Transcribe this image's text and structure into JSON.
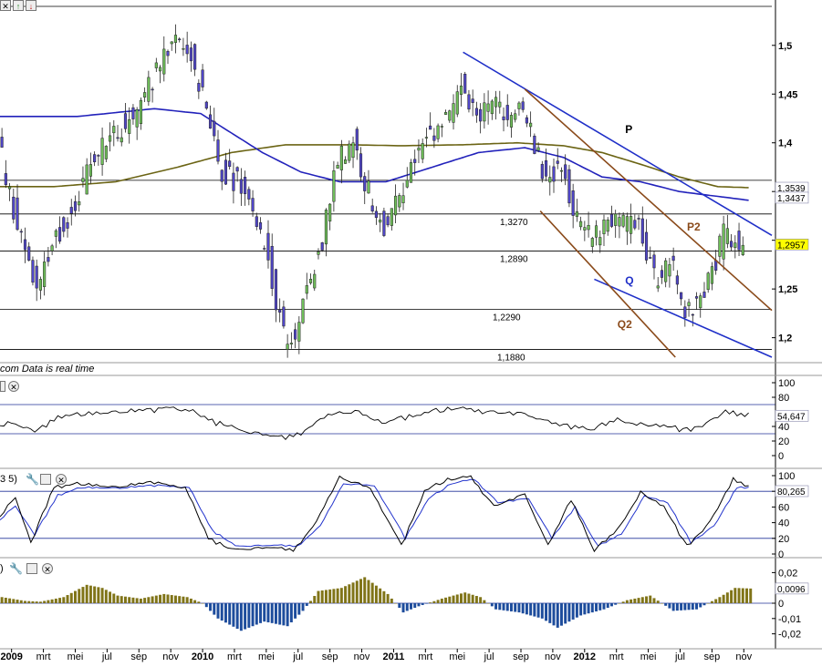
{
  "status_text": "com  Data is real time",
  "colors": {
    "candle_up": "#6fbf5a",
    "candle_down": "#5046c8",
    "ma_fast": "#2222bb",
    "ma_slow": "#6b6414",
    "trend_blue": "#1f2fc8",
    "trend_brown": "#8a4a1a",
    "rsi_line": "#000000",
    "stoch_k": "#000000",
    "stoch_d": "#2233cc",
    "macd_pos": "#807418",
    "macd_neg": "#1d4c9c",
    "last_price_bg": "#ffff00"
  },
  "toolbar_icons": [
    "close-icon",
    "arrow-up-icon",
    "arrow-down-icon"
  ],
  "panel_labels": {
    "stoch_params": "3 5)",
    "macd_params": ")"
  },
  "chart_data": [
    {
      "type": "candlestick",
      "name": "main-price-panel",
      "ylim": [
        1.18,
        1.54
      ],
      "yticks": [
        {
          "value": 1.5,
          "label": "1,5"
        },
        {
          "value": 1.45,
          "label": "1,45"
        },
        {
          "value": 1.4,
          "label": "1,4"
        },
        {
          "value": 1.35,
          "label": ""
        },
        {
          "value": 1.3,
          "label": ""
        },
        {
          "value": 1.25,
          "label": "1,25"
        },
        {
          "value": 1.2,
          "label": "1,2"
        }
      ],
      "xticks": [
        {
          "label": "2009",
          "bold": true
        },
        {
          "label": "mrt",
          "bold": false
        },
        {
          "label": "mei",
          "bold": false
        },
        {
          "label": "jul",
          "bold": false
        },
        {
          "label": "sep",
          "bold": false
        },
        {
          "label": "nov",
          "bold": false
        },
        {
          "label": "2010",
          "bold": true
        },
        {
          "label": "mrt",
          "bold": false
        },
        {
          "label": "mei",
          "bold": false
        },
        {
          "label": "jul",
          "bold": false
        },
        {
          "label": "sep",
          "bold": false
        },
        {
          "label": "nov",
          "bold": false
        },
        {
          "label": "2011",
          "bold": true
        },
        {
          "label": "mrt",
          "bold": false
        },
        {
          "label": "mei",
          "bold": false
        },
        {
          "label": "jul",
          "bold": false
        },
        {
          "label": "sep",
          "bold": false
        },
        {
          "label": "nov",
          "bold": false
        },
        {
          "label": "2012",
          "bold": true
        },
        {
          "label": "mrt",
          "bold": false
        },
        {
          "label": "mei",
          "bold": false
        },
        {
          "label": "jul",
          "bold": false
        },
        {
          "label": "sep",
          "bold": false
        },
        {
          "label": "nov",
          "bold": false
        }
      ],
      "weeks_total": 200,
      "price_keypoints": [
        [
          0,
          1.4
        ],
        [
          6,
          1.3
        ],
        [
          10,
          1.25
        ],
        [
          14,
          1.3
        ],
        [
          18,
          1.32
        ],
        [
          24,
          1.38
        ],
        [
          30,
          1.41
        ],
        [
          36,
          1.43
        ],
        [
          42,
          1.48
        ],
        [
          46,
          1.51
        ],
        [
          50,
          1.49
        ],
        [
          54,
          1.43
        ],
        [
          58,
          1.37
        ],
        [
          62,
          1.36
        ],
        [
          66,
          1.33
        ],
        [
          70,
          1.28
        ],
        [
          74,
          1.2
        ],
        [
          77,
          1.2
        ],
        [
          80,
          1.25
        ],
        [
          84,
          1.3
        ],
        [
          88,
          1.38
        ],
        [
          92,
          1.4
        ],
        [
          96,
          1.35
        ],
        [
          100,
          1.31
        ],
        [
          104,
          1.35
        ],
        [
          108,
          1.38
        ],
        [
          112,
          1.41
        ],
        [
          116,
          1.42
        ],
        [
          120,
          1.46
        ],
        [
          124,
          1.42
        ],
        [
          128,
          1.44
        ],
        [
          132,
          1.42
        ],
        [
          136,
          1.44
        ],
        [
          138,
          1.41
        ],
        [
          142,
          1.36
        ],
        [
          146,
          1.38
        ],
        [
          150,
          1.32
        ],
        [
          154,
          1.3
        ],
        [
          158,
          1.32
        ],
        [
          162,
          1.32
        ],
        [
          166,
          1.31
        ],
        [
          170,
          1.26
        ],
        [
          174,
          1.28
        ],
        [
          178,
          1.23
        ],
        [
          182,
          1.24
        ],
        [
          186,
          1.28
        ],
        [
          188,
          1.31
        ],
        [
          192,
          1.295
        ]
      ],
      "ma_fast_keypoints": [
        [
          0,
          1.427
        ],
        [
          20,
          1.427
        ],
        [
          40,
          1.435
        ],
        [
          52,
          1.43
        ],
        [
          60,
          1.41
        ],
        [
          68,
          1.39
        ],
        [
          78,
          1.37
        ],
        [
          88,
          1.36
        ],
        [
          100,
          1.36
        ],
        [
          112,
          1.375
        ],
        [
          124,
          1.39
        ],
        [
          136,
          1.395
        ],
        [
          146,
          1.385
        ],
        [
          156,
          1.365
        ],
        [
          166,
          1.36
        ],
        [
          176,
          1.35
        ],
        [
          186,
          1.345
        ],
        [
          194,
          1.341
        ]
      ],
      "ma_slow_keypoints": [
        [
          0,
          1.355
        ],
        [
          14,
          1.355
        ],
        [
          30,
          1.36
        ],
        [
          46,
          1.375
        ],
        [
          60,
          1.39
        ],
        [
          74,
          1.398
        ],
        [
          90,
          1.398
        ],
        [
          104,
          1.397
        ],
        [
          120,
          1.398
        ],
        [
          134,
          1.4
        ],
        [
          146,
          1.397
        ],
        [
          156,
          1.39
        ],
        [
          166,
          1.378
        ],
        [
          176,
          1.365
        ],
        [
          186,
          1.355
        ],
        [
          194,
          1.354
        ]
      ],
      "horizontal_levels": [
        {
          "value": 1.54,
          "label": ""
        },
        {
          "value": 1.3615,
          "label": ""
        },
        {
          "value": 1.327,
          "label": "1,3270"
        },
        {
          "value": 1.289,
          "label": "1,2890"
        },
        {
          "value": 1.229,
          "label": "1,2290"
        },
        {
          "value": 1.188,
          "label": "1,1880"
        }
      ],
      "trendlines": [
        {
          "name": "P",
          "color": "trend_blue",
          "from": [
            120,
            1.493
          ],
          "to": [
            200,
            1.305
          ]
        },
        {
          "name": "Q",
          "color": "trend_blue",
          "from": [
            154,
            1.26
          ],
          "to": [
            200,
            1.18
          ]
        },
        {
          "name": "P2",
          "color": "trend_brown",
          "from": [
            136,
            1.455
          ],
          "to": [
            200,
            1.228
          ]
        },
        {
          "name": "Q2",
          "color": "trend_brown",
          "from": [
            140,
            1.33
          ],
          "to": [
            175,
            1.18
          ]
        }
      ],
      "annotations": [
        {
          "text": "P",
          "at": [
            162,
            1.41
          ],
          "color": "#000000"
        },
        {
          "text": "Q",
          "at": [
            162,
            1.255
          ],
          "color": "#1f2fc8"
        },
        {
          "text": "P2",
          "at": [
            178,
            1.31
          ],
          "color": "#8a4a1a"
        },
        {
          "text": "Q2",
          "at": [
            160,
            1.21
          ],
          "color": "#8a4a1a"
        }
      ],
      "price_tags": [
        {
          "value": 1.3539,
          "label": "1,3539",
          "bg": "#ffffff",
          "color": "#6b6414"
        },
        {
          "value": 1.3437,
          "label": "1,3437",
          "bg": "#ffffff",
          "color": "#2222bb"
        },
        {
          "value": 1.2957,
          "label": "1,2957",
          "bg": "#ffff00",
          "color": "#000000"
        }
      ]
    },
    {
      "type": "line",
      "name": "rsi-panel",
      "ylim": [
        0,
        100
      ],
      "yticks": [
        {
          "value": 100,
          "label": "100"
        },
        {
          "value": 80,
          "label": "80"
        },
        {
          "value": 40,
          "label": "40"
        },
        {
          "value": 20,
          "label": "20"
        },
        {
          "value": 0,
          "label": "0"
        }
      ],
      "levels": [
        70,
        30
      ],
      "last_value": {
        "value": 54.647,
        "label": "54,647"
      },
      "keypoints": [
        [
          0,
          45
        ],
        [
          6,
          38
        ],
        [
          10,
          35
        ],
        [
          16,
          55
        ],
        [
          24,
          58
        ],
        [
          32,
          60
        ],
        [
          40,
          63
        ],
        [
          44,
          68
        ],
        [
          50,
          60
        ],
        [
          56,
          45
        ],
        [
          62,
          35
        ],
        [
          70,
          30
        ],
        [
          74,
          25
        ],
        [
          78,
          32
        ],
        [
          86,
          56
        ],
        [
          92,
          62
        ],
        [
          100,
          45
        ],
        [
          106,
          53
        ],
        [
          112,
          60
        ],
        [
          118,
          65
        ],
        [
          122,
          62
        ],
        [
          128,
          58
        ],
        [
          136,
          55
        ],
        [
          142,
          45
        ],
        [
          148,
          40
        ],
        [
          154,
          38
        ],
        [
          160,
          48
        ],
        [
          166,
          45
        ],
        [
          172,
          40
        ],
        [
          178,
          35
        ],
        [
          184,
          45
        ],
        [
          188,
          60
        ],
        [
          192,
          55
        ]
      ]
    },
    {
      "type": "line",
      "name": "stochastic-panel",
      "ylim": [
        0,
        100
      ],
      "yticks": [
        {
          "value": 100,
          "label": "100"
        },
        {
          "value": 80,
          "label": "80"
        },
        {
          "value": 60,
          "label": "60"
        },
        {
          "value": 40,
          "label": "40"
        },
        {
          "value": 20,
          "label": "20"
        },
        {
          "value": 0,
          "label": "0"
        }
      ],
      "levels": [
        80,
        20
      ],
      "last_value": {
        "value": 80.265,
        "label": "80,265"
      },
      "k_keypoints": [
        [
          0,
          50
        ],
        [
          4,
          70
        ],
        [
          8,
          15
        ],
        [
          14,
          85
        ],
        [
          20,
          90
        ],
        [
          30,
          85
        ],
        [
          40,
          92
        ],
        [
          48,
          85
        ],
        [
          54,
          20
        ],
        [
          60,
          5
        ],
        [
          70,
          10
        ],
        [
          76,
          5
        ],
        [
          82,
          40
        ],
        [
          88,
          98
        ],
        [
          96,
          85
        ],
        [
          104,
          10
        ],
        [
          110,
          80
        ],
        [
          116,
          95
        ],
        [
          122,
          98
        ],
        [
          128,
          60
        ],
        [
          136,
          75
        ],
        [
          142,
          10
        ],
        [
          148,
          70
        ],
        [
          154,
          5
        ],
        [
          160,
          30
        ],
        [
          166,
          80
        ],
        [
          172,
          60
        ],
        [
          178,
          10
        ],
        [
          184,
          40
        ],
        [
          190,
          95
        ],
        [
          194,
          85
        ]
      ],
      "d_keypoints": [
        [
          0,
          45
        ],
        [
          4,
          60
        ],
        [
          9,
          25
        ],
        [
          15,
          75
        ],
        [
          21,
          85
        ],
        [
          31,
          84
        ],
        [
          41,
          88
        ],
        [
          49,
          85
        ],
        [
          55,
          30
        ],
        [
          61,
          10
        ],
        [
          71,
          12
        ],
        [
          77,
          10
        ],
        [
          83,
          35
        ],
        [
          89,
          90
        ],
        [
          97,
          88
        ],
        [
          105,
          20
        ],
        [
          111,
          70
        ],
        [
          117,
          90
        ],
        [
          123,
          95
        ],
        [
          129,
          65
        ],
        [
          137,
          70
        ],
        [
          143,
          20
        ],
        [
          149,
          60
        ],
        [
          155,
          10
        ],
        [
          161,
          25
        ],
        [
          167,
          75
        ],
        [
          173,
          65
        ],
        [
          179,
          15
        ],
        [
          185,
          35
        ],
        [
          191,
          85
        ],
        [
          194,
          84
        ]
      ]
    },
    {
      "type": "bar",
      "name": "macd-histogram-panel",
      "ylim": [
        -0.025,
        0.025
      ],
      "yticks": [
        {
          "value": 0.02,
          "label": "0,02"
        },
        {
          "value": 0,
          "label": "0"
        },
        {
          "value": -0.01,
          "label": "-0,01"
        },
        {
          "value": -0.02,
          "label": "-0,02"
        }
      ],
      "last_value": {
        "value": 0.0096,
        "label": "0,0096"
      },
      "keypoints": [
        [
          0,
          0.004
        ],
        [
          6,
          0.0015
        ],
        [
          10,
          0.001
        ],
        [
          16,
          0.004
        ],
        [
          22,
          0.012
        ],
        [
          26,
          0.01
        ],
        [
          30,
          0.005
        ],
        [
          36,
          0.003
        ],
        [
          42,
          0.006
        ],
        [
          48,
          0.004
        ],
        [
          52,
          0.0
        ],
        [
          56,
          -0.01
        ],
        [
          62,
          -0.018
        ],
        [
          68,
          -0.012
        ],
        [
          74,
          -0.015
        ],
        [
          78,
          -0.005
        ],
        [
          82,
          0.008
        ],
        [
          88,
          0.01
        ],
        [
          94,
          0.017
        ],
        [
          100,
          0.006
        ],
        [
          104,
          -0.006
        ],
        [
          108,
          -0.002
        ],
        [
          114,
          0.003
        ],
        [
          120,
          0.007
        ],
        [
          124,
          0.004
        ],
        [
          128,
          -0.004
        ],
        [
          134,
          -0.006
        ],
        [
          140,
          -0.01
        ],
        [
          144,
          -0.016
        ],
        [
          150,
          -0.008
        ],
        [
          156,
          -0.004
        ],
        [
          162,
          0.002
        ],
        [
          168,
          0.005
        ],
        [
          174,
          -0.005
        ],
        [
          180,
          -0.004
        ],
        [
          186,
          0.004
        ],
        [
          190,
          0.01
        ],
        [
          194,
          0.0096
        ]
      ]
    }
  ]
}
